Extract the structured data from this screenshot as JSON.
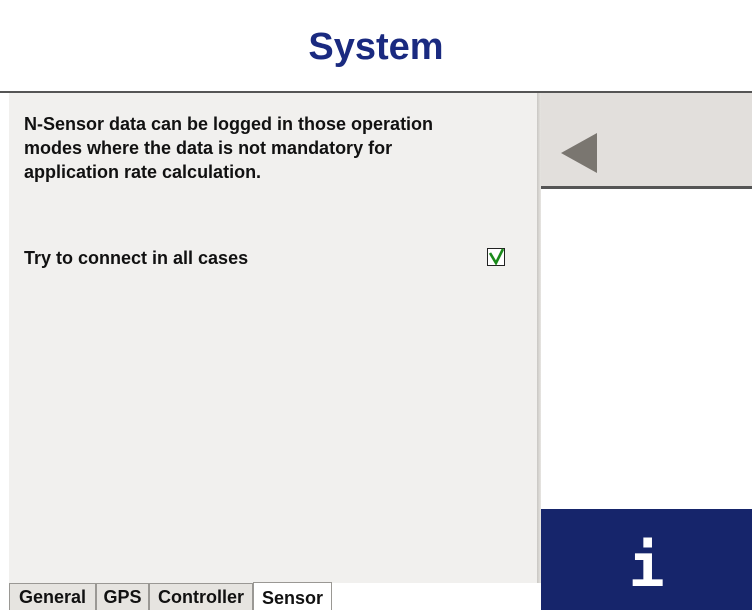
{
  "header": {
    "title": "System"
  },
  "main": {
    "info_text": "N-Sensor data can be logged in those operation modes where the data is not mandatory for application rate calculation.",
    "option": {
      "label": "Try to connect in all cases",
      "checked": true
    }
  },
  "right_panel": {
    "back_icon": "left-triangle-icon",
    "info_icon": "info-icon",
    "info_symbol": "i"
  },
  "tabs": [
    {
      "label": "General",
      "active": false
    },
    {
      "label": "GPS",
      "active": false
    },
    {
      "label": "Controller",
      "active": false
    },
    {
      "label": "Sensor",
      "active": true
    }
  ],
  "colors": {
    "title": "#1a2a80",
    "info_button": "#16256b",
    "panel_bg": "#f1f0ee",
    "check_mark": "#1a8a1a"
  }
}
